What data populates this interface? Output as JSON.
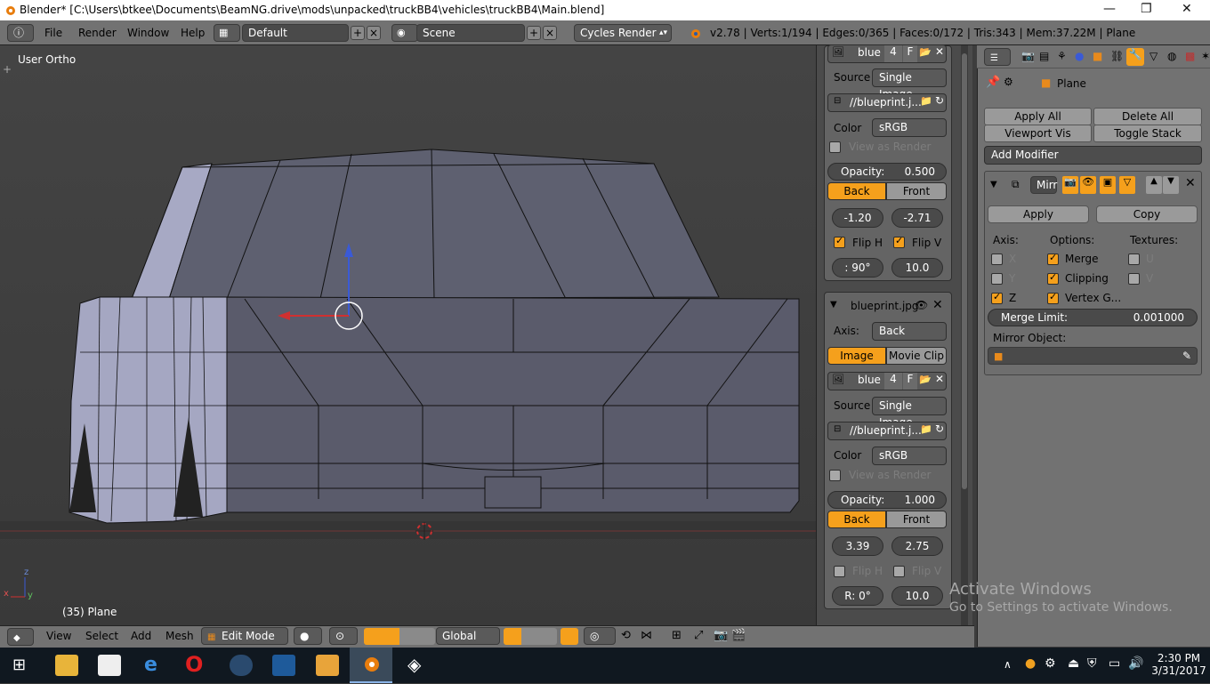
{
  "titlebar": {
    "title": "Blender* [C:\\Users\\btkee\\Documents\\BeamNG.drive\\mods\\unpacked\\truckBB4\\vehicles\\truckBB4\\Main.blend]",
    "minimize": "—",
    "maximize": "❐",
    "close": "✕"
  },
  "info_header": {
    "menus": [
      "File",
      "Render",
      "Window",
      "Help"
    ],
    "layout": "Default",
    "scene": "Scene",
    "engine": "Cycles Render",
    "stats": "v2.78 | Verts:1/194 | Edges:0/365 | Faces:0/172 | Tris:343 | Mem:37.22M | Plane"
  },
  "viewport": {
    "view_name": "User Ortho",
    "object_label": "(35) Plane",
    "axis_z": "z",
    "axis_x": "x",
    "axis_y": "y"
  },
  "bg_images": {
    "img1": {
      "image_name": "blue",
      "users": "4",
      "fake": "F",
      "source_label": "Source",
      "source": "Single Image",
      "filepath": "//blueprint.j...",
      "color_label": "Color",
      "color": "sRGB",
      "view_as_render": "View as Render",
      "opacity_label": "Opacity:",
      "opacity": "0.500",
      "back": "Back",
      "front": "Front",
      "offset_x": "-1.20",
      "offset_y": "-2.71",
      "flip_h": "Flip H",
      "flip_v": "Flip V",
      "rotation": ": 90°",
      "size": "10.0"
    },
    "img2": {
      "header": "blueprint.jpg",
      "axis_label": "Axis:",
      "axis": "Back",
      "image_tab": "Image",
      "movie_tab": "Movie Clip",
      "image_name": "blue",
      "users": "4",
      "fake": "F",
      "source_label": "Source",
      "source": "Single Image",
      "filepath": "//blueprint.j...",
      "color_label": "Color",
      "color": "sRGB",
      "view_as_render": "View as Render",
      "opacity_label": "Opacity:",
      "opacity": "1.000",
      "back": "Back",
      "front": "Front",
      "offset_x": "3.39",
      "offset_y": "2.75",
      "flip_h": "Flip H",
      "flip_v": "Flip V",
      "rotation": "R: 0°",
      "size": "10.0"
    }
  },
  "properties": {
    "breadcrumb_object": "Plane",
    "apply_all": "Apply All",
    "delete_all": "Delete All",
    "viewport_vis": "Viewport Vis",
    "toggle_stack": "Toggle Stack",
    "add_modifier": "Add Modifier",
    "modifier_name": "Mirr",
    "apply": "Apply",
    "copy": "Copy",
    "axis_label": "Axis:",
    "options_label": "Options:",
    "textures_label": "Textures:",
    "x": "X",
    "y": "Y",
    "z": "Z",
    "merge": "Merge",
    "clipping": "Clipping",
    "vertex_groups": "Vertex G...",
    "u": "U",
    "v": "V",
    "merge_limit_label": "Merge Limit:",
    "merge_limit": "0.001000",
    "mirror_object_label": "Mirror Object:"
  },
  "bottom_header": {
    "menus": [
      "View",
      "Select",
      "Add",
      "Mesh"
    ],
    "mode": "Edit Mode",
    "orientation": "Global"
  },
  "watermark": {
    "line1": "Activate Windows",
    "line2": "Go to Settings to activate Windows."
  },
  "taskbar": {
    "time": "2:30 PM",
    "date": "3/31/2017"
  },
  "colors": {
    "accent_orange": "#f5a01c",
    "header_gray": "#727272",
    "panel_gray": "#4b4b4b",
    "mesh_face": "#5c5d6e",
    "mesh_light": "#a8aac4",
    "taskbar": "#101820"
  }
}
